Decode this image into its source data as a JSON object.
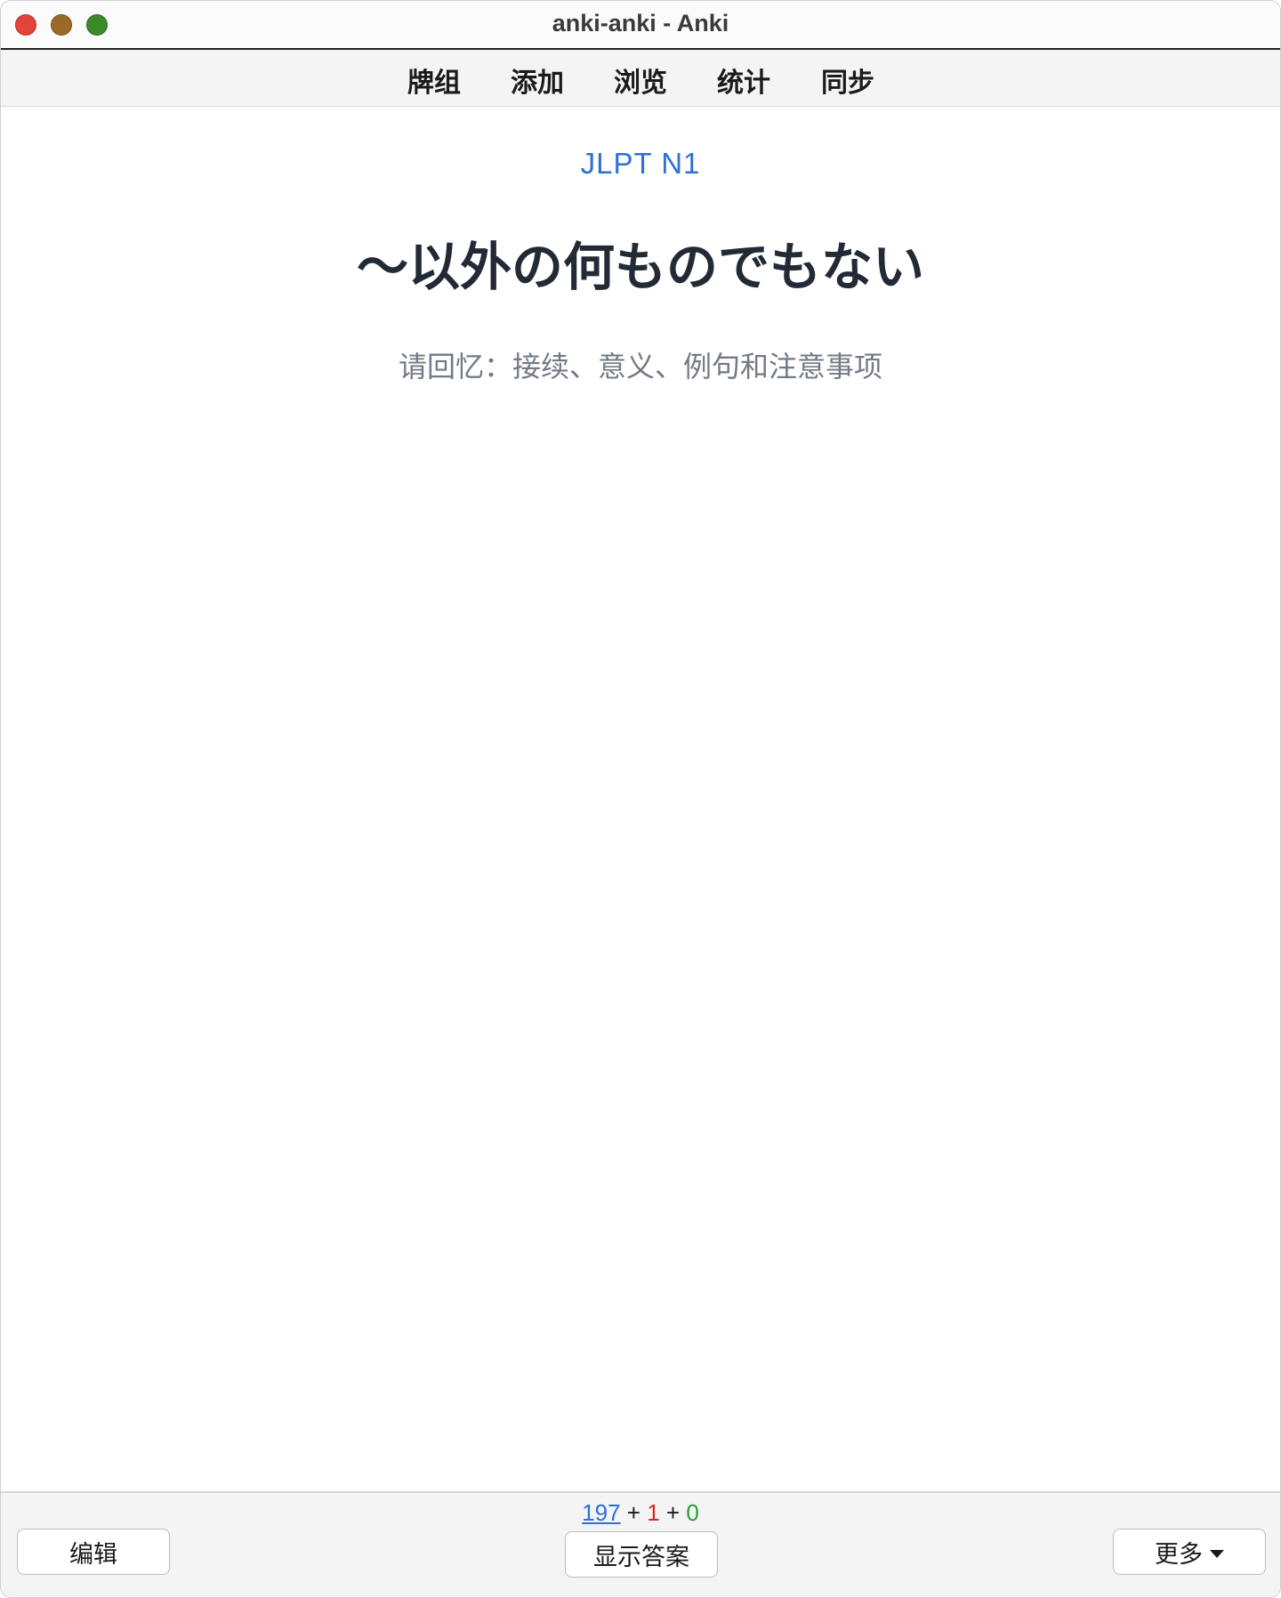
{
  "window": {
    "title": "anki-anki - Anki"
  },
  "toolbar": {
    "items": [
      {
        "label": "牌组"
      },
      {
        "label": "添加"
      },
      {
        "label": "浏览"
      },
      {
        "label": "统计"
      },
      {
        "label": "同步"
      }
    ]
  },
  "card": {
    "deck": "JLPT N1",
    "front": "〜以外の何ものでもない",
    "prompt": "请回忆：接续、意义、例句和注意事项"
  },
  "counts": {
    "new": "197",
    "sep1": " + ",
    "learn": "1",
    "sep2": " + ",
    "review": "0"
  },
  "bottom": {
    "edit_label": "编辑",
    "show_answer_label": "显示答案",
    "more_label": "更多"
  },
  "colors": {
    "new": "#2e6fd9",
    "learn": "#d22b2b",
    "review": "#2b9a3a",
    "deck_label": "#2e6fd9"
  }
}
